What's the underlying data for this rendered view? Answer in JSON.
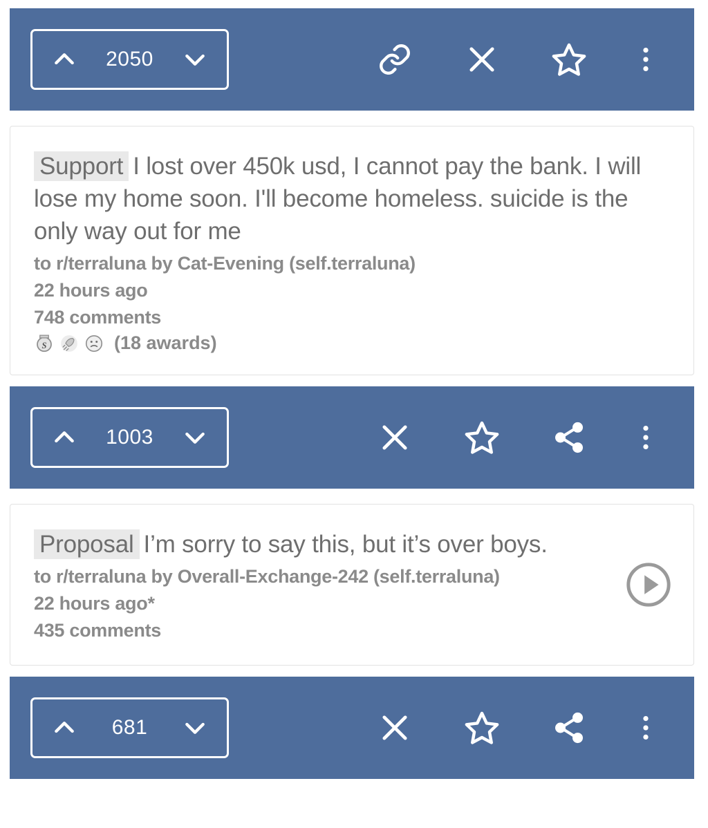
{
  "theme": {
    "toolbar_background": "#4e6d9c",
    "toolbar_foreground": "#ffffff",
    "card_background": "#ffffff",
    "title_color": "#6e6e6e",
    "meta_color": "#8a8a8a",
    "flair_background": "#e9e9e9"
  },
  "feed": {
    "toolbars": [
      {
        "vote_count": "2050",
        "upvote_icon": "chevron-up-icon",
        "downvote_icon": "chevron-down-icon",
        "actions": [
          "link-icon",
          "close-icon",
          "star-icon",
          "more-vertical-icon"
        ]
      },
      {
        "vote_count": "1003",
        "upvote_icon": "chevron-up-icon",
        "downvote_icon": "chevron-down-icon",
        "actions": [
          "close-icon",
          "star-icon",
          "share-icon",
          "more-vertical-icon"
        ]
      },
      {
        "vote_count": "681",
        "upvote_icon": "chevron-up-icon",
        "downvote_icon": "chevron-down-icon",
        "actions": [
          "close-icon",
          "star-icon",
          "share-icon",
          "more-vertical-icon"
        ]
      }
    ],
    "posts": [
      {
        "flair": "Support",
        "title": "I lost over 450k usd, I cannot pay the bank. I will lose my home soon. I'll become homeless. suicide is the only way out for me",
        "byline": "to r/terraluna by Cat-Evening  (self.terraluna)",
        "timestamp": "22 hours ago",
        "comments": "748 comments",
        "awards_label": "(18 awards)",
        "award_icons": [
          "silver-award-icon",
          "rocket-award-icon",
          "face-award-icon"
        ],
        "has_play_button": false
      },
      {
        "flair": "Proposal",
        "title": "I’m sorry to say this, but it’s over boys.",
        "byline": "to r/terraluna by Overall-Exchange-242 (self.terraluna)",
        "timestamp": "22 hours ago*",
        "comments": "435 comments",
        "awards_label": "",
        "award_icons": [],
        "has_play_button": true,
        "play_icon": "play-circle-icon"
      }
    ]
  }
}
